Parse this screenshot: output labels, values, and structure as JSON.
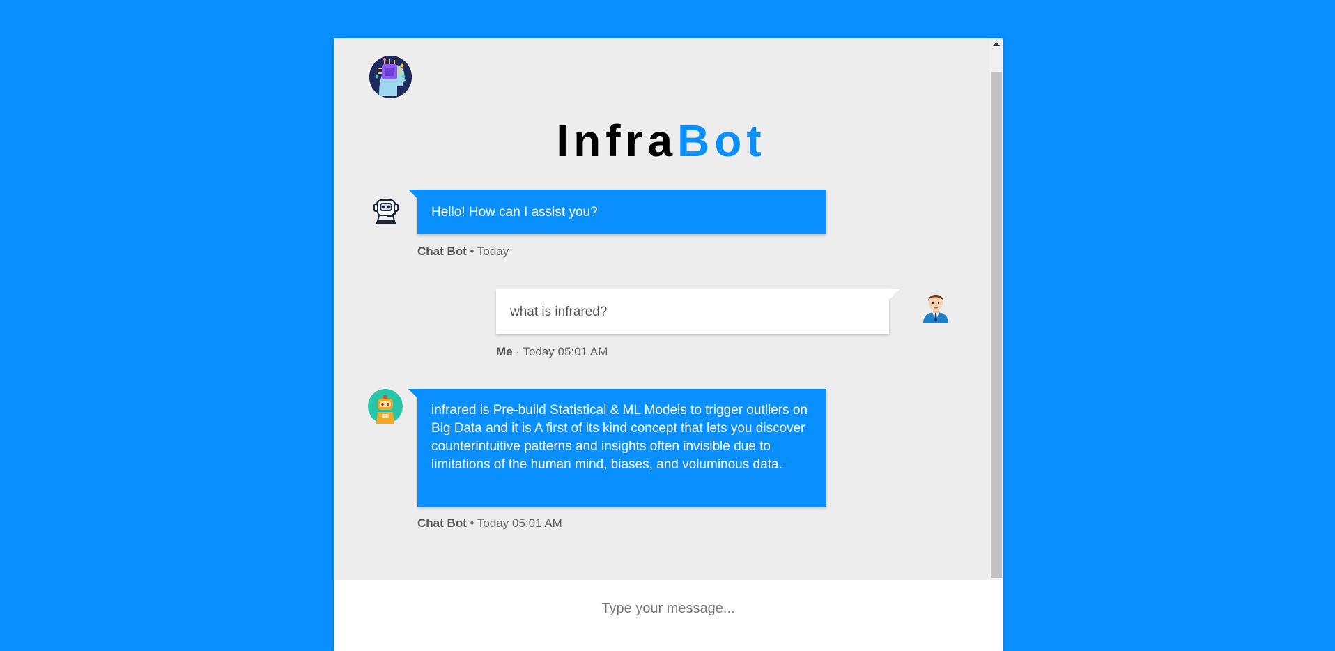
{
  "app": {
    "title_part1": "Infra",
    "title_part2": "Bot"
  },
  "messages": [
    {
      "sender": "Chat Bot",
      "separator": " • ",
      "time": "Today",
      "text": "Hello! How can I assist you?",
      "avatar": "robot-headset-icon"
    },
    {
      "sender": "Me",
      "separator": " · ",
      "time": "Today 05:01 AM",
      "text": "what is infrared?",
      "avatar": "businessman-icon"
    },
    {
      "sender": "Chat Bot",
      "separator": " • ",
      "time": "Today 05:01 AM",
      "text": "infrared is Pre-build Statistical & ML Models to trigger outliers on Big Data and it is A first of its kind concept that lets you discover counterintuitive patterns and insights often invisible due to limitations of the human mind, biases, and voluminous data.",
      "avatar": "orange-robot-icon"
    }
  ],
  "input": {
    "placeholder": "Type your message..."
  },
  "colors": {
    "accent": "#0a8fff",
    "panel": "#ededed",
    "user_bubble": "#ffffff"
  }
}
